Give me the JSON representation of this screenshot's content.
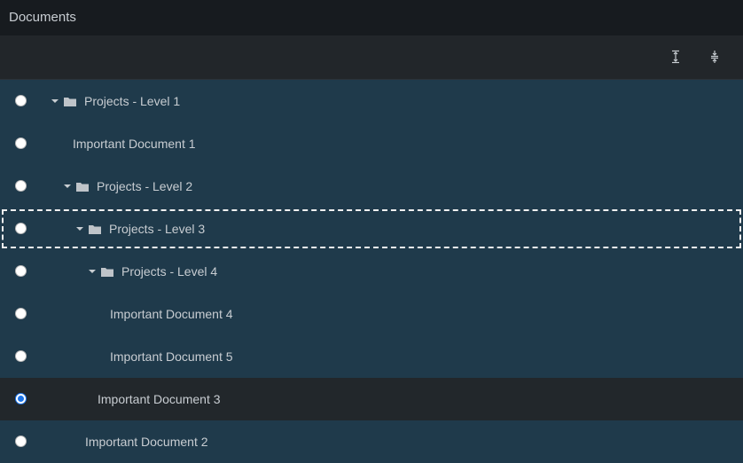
{
  "window": {
    "title": "Documents"
  },
  "toolbar": {
    "expand_all_icon": "expand-all-icon",
    "collapse_all_icon": "collapse-all-icon"
  },
  "tree": {
    "items": [
      {
        "label": "Projects - Level 1",
        "type": "folder",
        "expanded": true,
        "checked": false
      },
      {
        "label": "Important Document 1",
        "type": "document",
        "checked": false
      },
      {
        "label": "Projects - Level 2",
        "type": "folder",
        "expanded": true,
        "checked": false
      },
      {
        "label": "Projects - Level 3",
        "type": "folder",
        "expanded": true,
        "checked": false,
        "focused": true
      },
      {
        "label": "Projects - Level 4",
        "type": "folder",
        "expanded": true,
        "checked": false
      },
      {
        "label": "Important Document 4",
        "type": "document",
        "checked": false
      },
      {
        "label": "Important Document 5",
        "type": "document",
        "checked": false
      },
      {
        "label": "Important Document 3",
        "type": "document",
        "checked": true,
        "selected": true
      },
      {
        "label": "Important Document 2",
        "type": "document",
        "checked": false
      }
    ]
  },
  "colors": {
    "row_background": "#1f3a4b",
    "selected_row_background": "#22272b",
    "text": "#c8cdd2",
    "radio_checked": "#1a73e8"
  }
}
